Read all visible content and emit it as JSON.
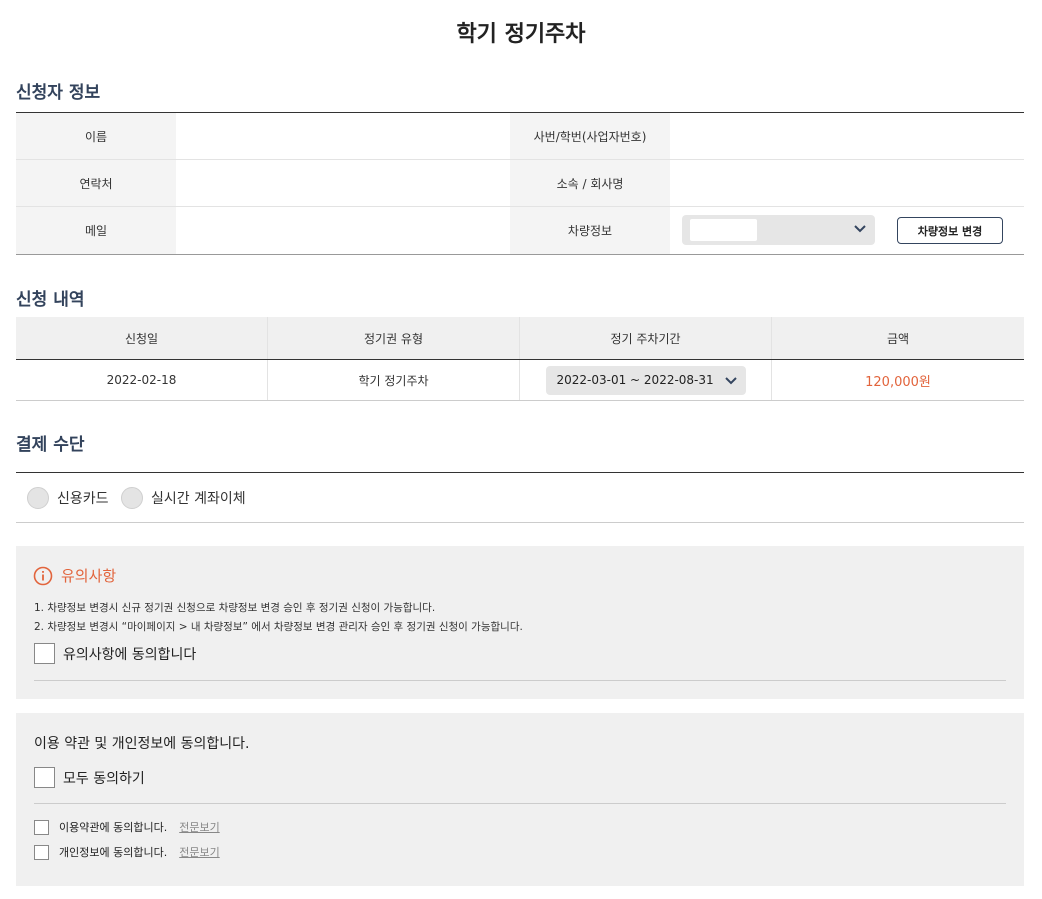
{
  "page": {
    "title": "학기 정기주차"
  },
  "applicant": {
    "section_title": "신청자 정보",
    "name_label": "이름",
    "id_label": "사번/학번(사업자번호)",
    "phone_label": "연락처",
    "org_label": "소속 / 회사명",
    "email_label": "메일",
    "car_label": "차량정보",
    "car_change_button": "차량정보 변경"
  },
  "history": {
    "section_title": "신청 내역",
    "headers": [
      "신청일",
      "정기권 유형",
      "정기 주차기간",
      "금액"
    ],
    "row": {
      "date": "2022-02-18",
      "type": "학기 정기주차",
      "period": "2022-03-01 ~ 2022-08-31",
      "amount": "120,000원"
    }
  },
  "payment": {
    "section_title": "결제 수단",
    "options": [
      "신용카드",
      "실시간 계좌이체"
    ]
  },
  "notice": {
    "title": "유의사항",
    "lines": [
      "1. 차량정보 변경시 신규 정기권 신청으로 차량정보 변경 승인 후 정기권 신청이 가능합니다.",
      "2. 차량정보 변경시 “마이페이지 > 내 차량정보” 에서 차량정보 변경 관리자 승인 후 정기권 신청이 가능합니다."
    ],
    "agree_label": "유의사항에 동의합니다"
  },
  "terms": {
    "title": "이용 약관 및 개인정보에 동의합니다.",
    "all_label": "모두 동의하기",
    "items": [
      {
        "label": "이용약관에 동의합니다.",
        "link": "전문보기"
      },
      {
        "label": "개인정보에 동의합니다.",
        "link": "전문보기"
      }
    ]
  },
  "colors": {
    "accent": "#e2643c",
    "heading": "#33435c",
    "panel_bg": "#f0f0f0"
  }
}
